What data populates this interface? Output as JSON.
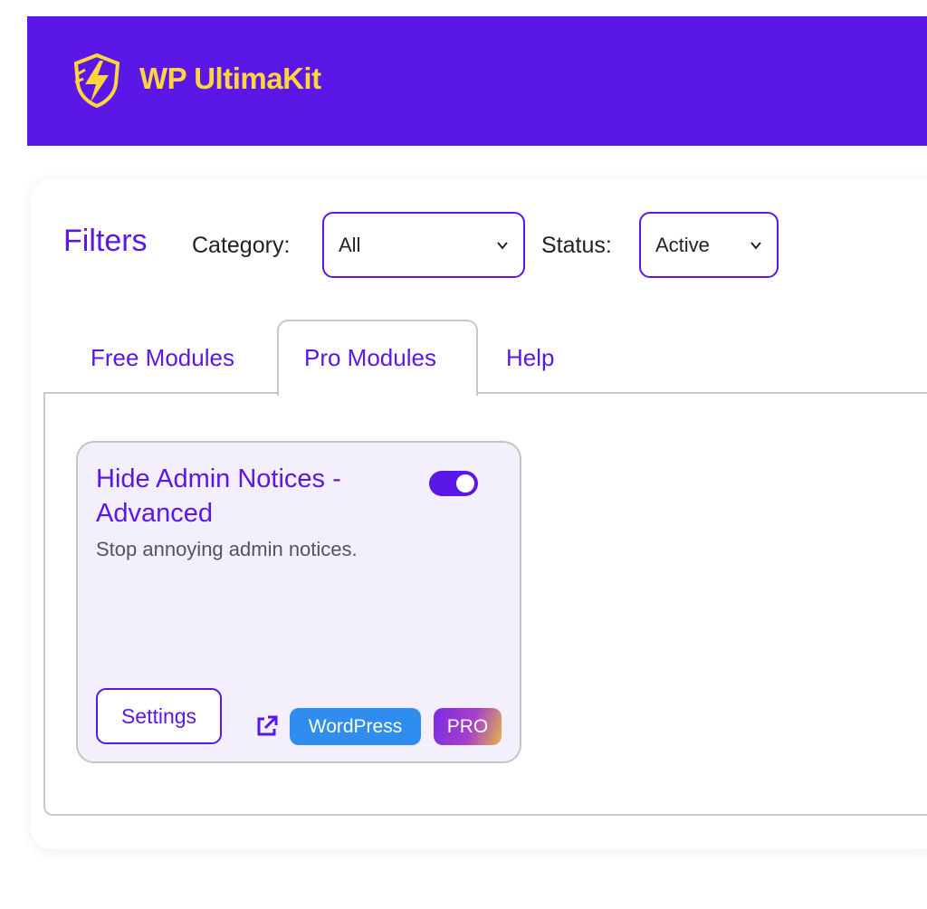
{
  "app": {
    "brand": "WP UltimaKit",
    "brand_color": "#5b17e8",
    "logo_color": "#ffd53e"
  },
  "filters": {
    "title": "Filters",
    "category_label": "Category:",
    "category_value": "All",
    "status_label": "Status:",
    "status_value": "Active"
  },
  "tabs": [
    {
      "label": "Free Modules",
      "active": false
    },
    {
      "label": "Pro Modules",
      "active": true
    },
    {
      "label": "Help",
      "active": false
    }
  ],
  "modules": [
    {
      "title": "Hide Admin Notices - Advanced",
      "description": "Stop annoying admin notices.",
      "enabled": true,
      "settings_label": "Settings",
      "tags": [
        "WordPress",
        "PRO"
      ],
      "link_icon": "external-link-icon"
    }
  ]
}
